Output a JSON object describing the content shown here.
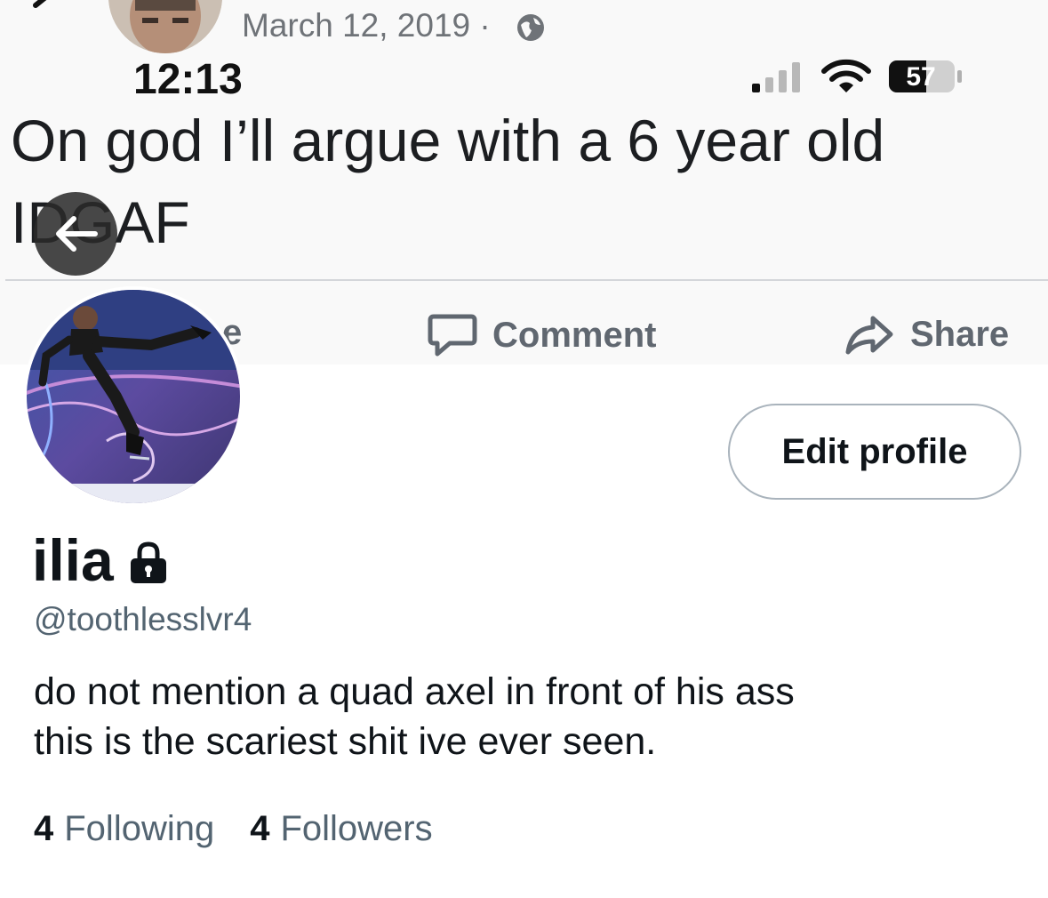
{
  "banner": {
    "post_date": "March 12, 2019 ·",
    "status_time": "12:13",
    "battery_level": "57",
    "post_text_line1": "On god I’ll argue with a 6 year old",
    "post_text_line2": "IDGAF",
    "like_fragment": "e",
    "comment_label": "Comment",
    "share_label": "Share"
  },
  "profile": {
    "edit_button": "Edit profile",
    "display_name": "ilia",
    "handle": "@toothlesslvr4",
    "bio_line1": "do not mention a quad axel in front of his ass",
    "bio_line2": "this is the scariest shit ive ever seen.",
    "following_count": "4",
    "following_label": "Following",
    "followers_count": "4",
    "followers_label": "Followers"
  },
  "icons": {
    "back": "back-arrow-icon",
    "lock": "lock-icon",
    "globe": "globe-icon",
    "signal": "signal-icon",
    "wifi": "wifi-icon",
    "battery": "battery-icon",
    "comment": "comment-icon",
    "share": "share-icon"
  },
  "colors": {
    "text_primary": "#0f1419",
    "text_secondary": "#536471",
    "banner_bg": "#f9f9f9",
    "fb_action_gray": "#606770",
    "button_border": "#a9b3bc"
  }
}
